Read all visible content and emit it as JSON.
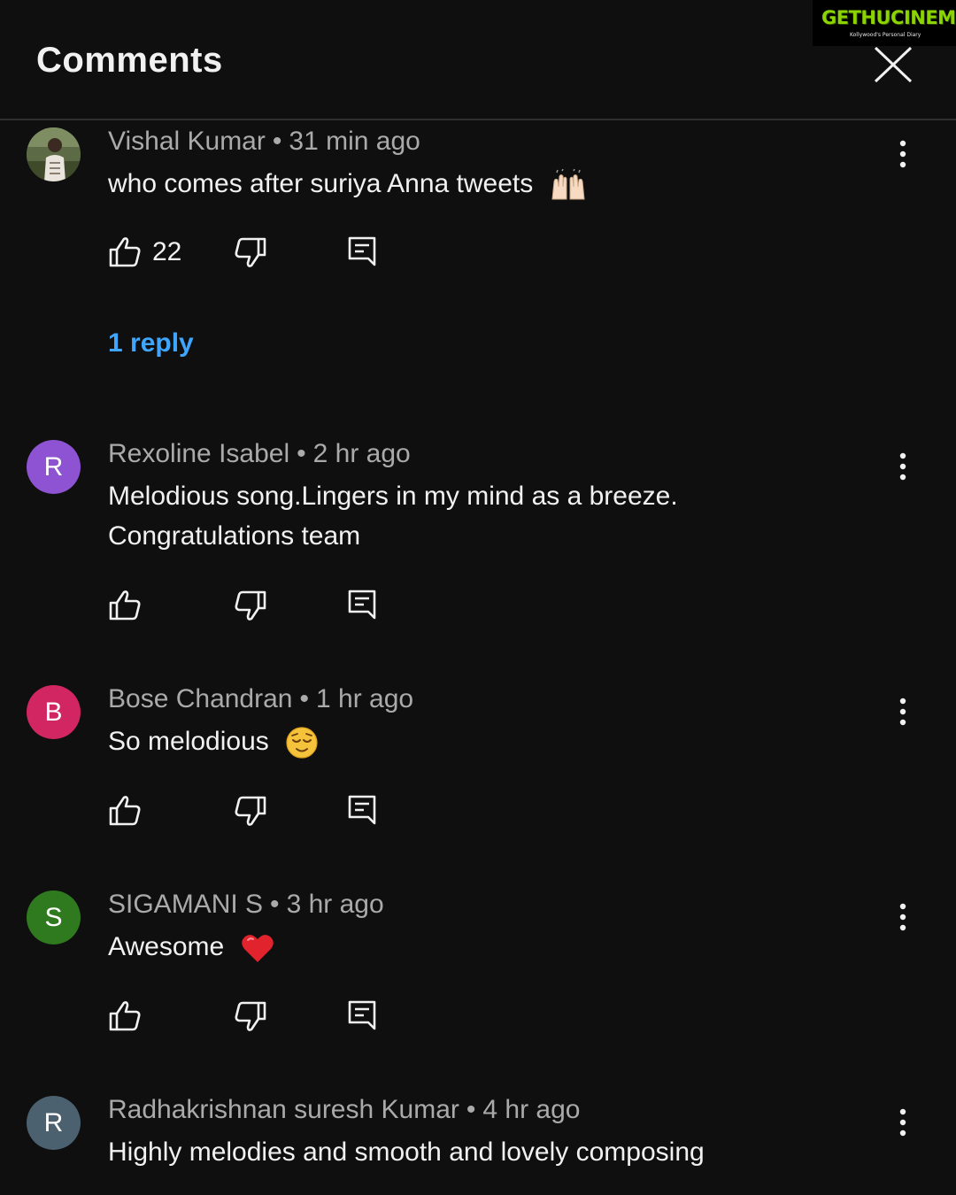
{
  "header": {
    "title": "Comments",
    "close_icon": "close-icon"
  },
  "watermark": {
    "brand": "GETHUCINEMA",
    "tagline": "Kollywood's Personal Diary"
  },
  "comments": [
    {
      "author": "Vishal Kumar",
      "separator": "•",
      "time": "31 min ago",
      "text": "who comes after suriya Anna tweets",
      "emoji": "raising-hands-emoji",
      "like_count": "22",
      "replies_label": "1 reply",
      "avatar": {
        "type": "photo"
      }
    },
    {
      "author": "Rexoline Isabel",
      "separator": "•",
      "time": "2 hr ago",
      "text_lines": [
        "Melodious song.Lingers in my mind as a breeze.",
        "Congratulations team"
      ],
      "like_count": "",
      "avatar": {
        "type": "initial",
        "letter": "R",
        "color": "#8e53d3"
      }
    },
    {
      "author": "Bose Chandran",
      "separator": "•",
      "time": "1 hr ago",
      "text": "So melodious",
      "emoji": "relieved-face-emoji",
      "like_count": "",
      "avatar": {
        "type": "initial",
        "letter": "B",
        "color": "#d22662"
      }
    },
    {
      "author": "SIGAMANI S",
      "separator": "•",
      "time": "3 hr ago",
      "text": "Awesome",
      "emoji": "red-heart-emoji",
      "like_count": "",
      "avatar": {
        "type": "initial",
        "letter": "S",
        "color": "#2f7a1f"
      }
    },
    {
      "author": "Radhakrishnan suresh Kumar",
      "separator": "•",
      "time": "4 hr ago",
      "text": "Highly melodies and smooth and lovely composing",
      "like_count": "",
      "avatar": {
        "type": "initial",
        "letter": "R",
        "color": "#4c6170"
      }
    }
  ],
  "colors": {
    "background": "#0f0f0f",
    "text": "#f1f1f1",
    "meta": "#aaaaaa",
    "link": "#3ea6ff",
    "divider": "#2f2f2f"
  }
}
